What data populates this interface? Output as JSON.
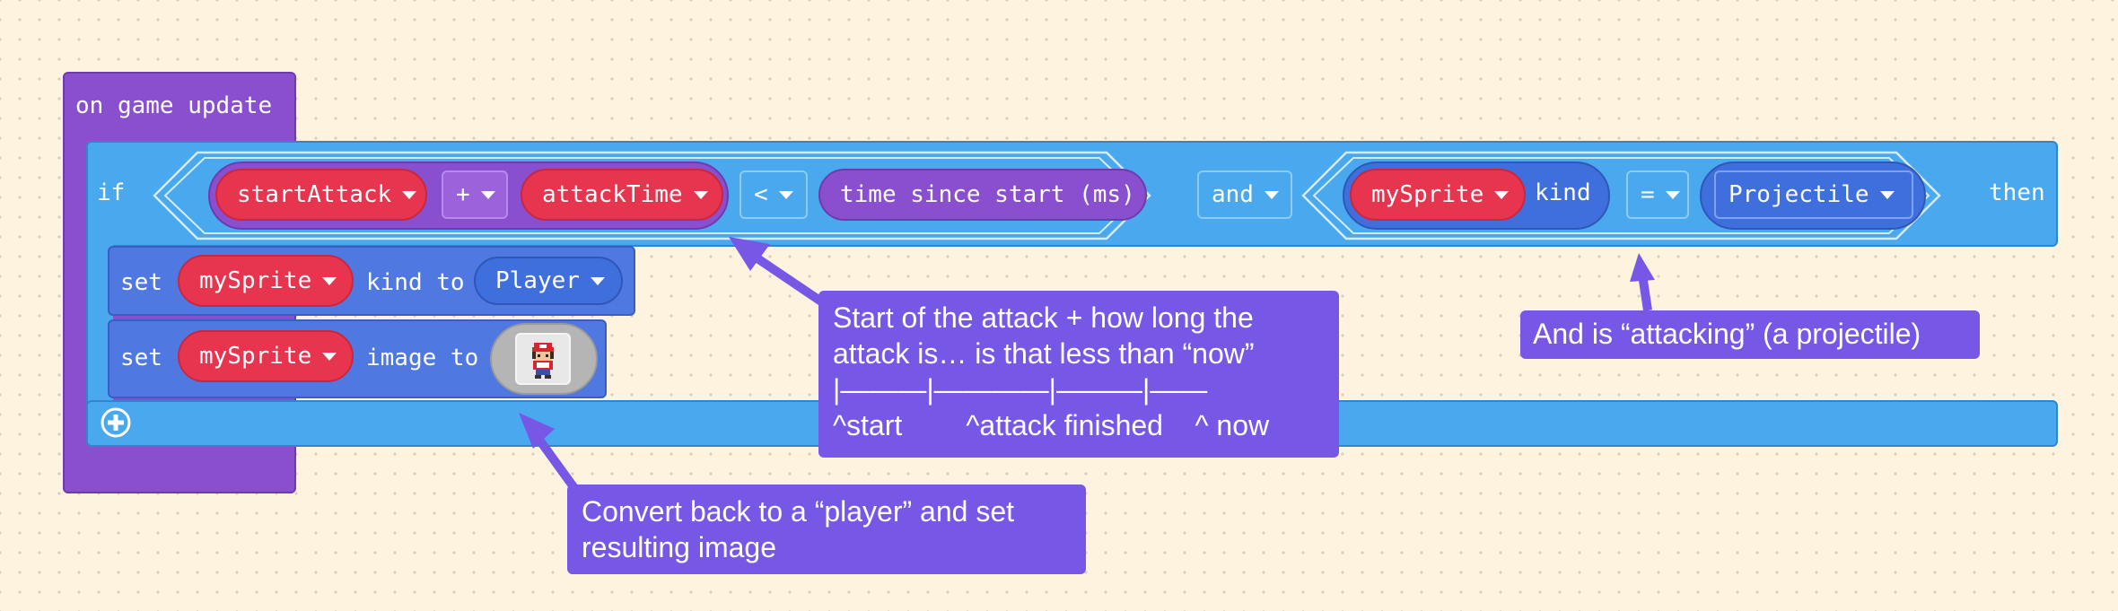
{
  "event": {
    "label": "on game update"
  },
  "if_block": {
    "if_label": "if",
    "then_label": "then",
    "cond1": {
      "left_var": "startAttack",
      "plus_op": "+",
      "right_var": "attackTime",
      "compare_op": "<",
      "time_label": "time since start (ms)"
    },
    "logic_op": "and",
    "cond2": {
      "sprite_var": "mySprite",
      "kind_label": "kind",
      "eq_op": "=",
      "kind_value": "Projectile"
    }
  },
  "set_kind": {
    "set_label": "set",
    "sprite_var": "mySprite",
    "middle_label": "kind to",
    "value": "Player"
  },
  "set_image": {
    "set_label": "set",
    "sprite_var": "mySprite",
    "middle_label": "image to",
    "image_icon": "red-cap-trainer-sprite"
  },
  "annotations": {
    "attack": {
      "line1": "Start of the attack + how long the",
      "line2": "attack is… is that less than “now”",
      "timeline": "|———|————|———|——",
      "labels": "^start        ^attack finished    ^ now"
    },
    "projectile": "And is “attacking” (a projectile)",
    "convert": {
      "line1": "Convert back to a “player” and set",
      "line2": "resulting image"
    }
  },
  "colors": {
    "event": "#8a4fcf",
    "if": "#4aa8ee",
    "variable": "#e8354f",
    "annotation": "#7657e6",
    "background": "#fdf3df"
  }
}
